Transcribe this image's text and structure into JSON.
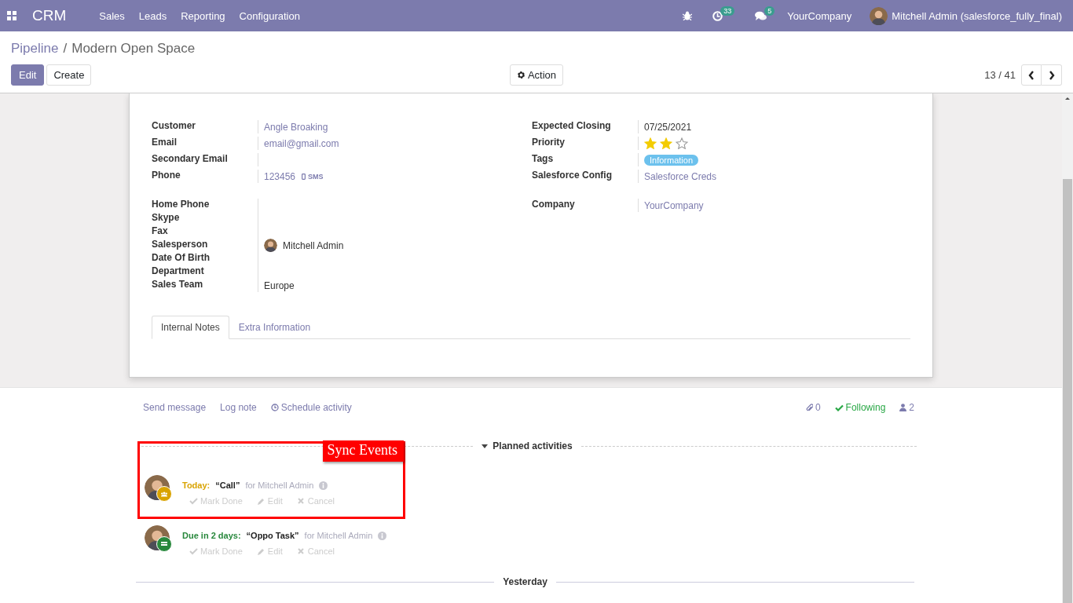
{
  "navbar": {
    "app": "CRM",
    "menus": [
      "Sales",
      "Leads",
      "Reporting",
      "Configuration"
    ],
    "activity_count": "33",
    "message_count": "5",
    "company": "YourCompany",
    "user": "Mitchell Admin (salesforce_fully_final)"
  },
  "breadcrumb": {
    "parent": "Pipeline",
    "separator": "/",
    "current": "Modern Open Space"
  },
  "buttons": [
    {
      "label": "Edit",
      "kind": "primary"
    },
    {
      "label": "Create",
      "kind": "secondary"
    }
  ],
  "action": "Action",
  "pager": "13 / 41",
  "left_groups": [
    [
      {
        "label": "Customer",
        "kind": "link",
        "value": "Angle Broaking"
      },
      {
        "label": "Email",
        "kind": "link",
        "value": "email@gmail.com"
      },
      {
        "label": "Secondary Email",
        "kind": "text"
      },
      {
        "label": "Phone",
        "kind": "phone",
        "value": "123456",
        "sms": "SMS"
      }
    ],
    [
      {
        "label": "Home Phone",
        "kind": "text"
      },
      {
        "label": "Skype",
        "kind": "text"
      },
      {
        "label": "Fax",
        "kind": "text"
      },
      {
        "label": "Salesperson",
        "kind": "user",
        "value": "Mitchell Admin"
      },
      {
        "label": "Date Of Birth",
        "kind": "text"
      },
      {
        "label": "Department",
        "kind": "text"
      },
      {
        "label": "Sales Team",
        "kind": "text",
        "value": "Europe"
      }
    ]
  ],
  "right_groups": [
    [
      {
        "label": "Expected Closing",
        "kind": "text",
        "value": "07/25/2021"
      },
      {
        "label": "Priority",
        "kind": "stars",
        "stars": 2
      },
      {
        "label": "Tags",
        "kind": "tag",
        "value": "Information",
        "color": "#6cc1ed"
      },
      {
        "label": "Salesforce Config",
        "kind": "link",
        "value": "Salesforce Creds"
      }
    ],
    [
      {
        "label": "Company",
        "kind": "link",
        "value": "YourCompany"
      }
    ]
  ],
  "tabs": [
    {
      "label": "Internal Notes",
      "selected": true
    },
    {
      "label": "Extra Information",
      "selected": false
    }
  ],
  "chatter": {
    "actions": [
      "Send message",
      "Log note",
      "Schedule activity"
    ],
    "attachments": "0",
    "following": "Following",
    "followers": "2"
  },
  "planned_title": "Planned activities",
  "activities": [
    {
      "due": "Today:",
      "color": "#d9a300",
      "title": "“Call”",
      "assignee": "for Mitchell Admin",
      "kind": "meeting",
      "actions": [
        "Mark Done",
        "Edit",
        "Cancel"
      ]
    },
    {
      "due": "Due in 2 days:",
      "color": "#28883c",
      "title": "“Oppo Task”",
      "assignee": "for Mitchell Admin",
      "kind": "task",
      "actions": [
        "Mark Done",
        "Edit",
        "Cancel"
      ]
    }
  ],
  "yesterday": "Yesterday",
  "annotation": {
    "label": "Sync Events"
  }
}
